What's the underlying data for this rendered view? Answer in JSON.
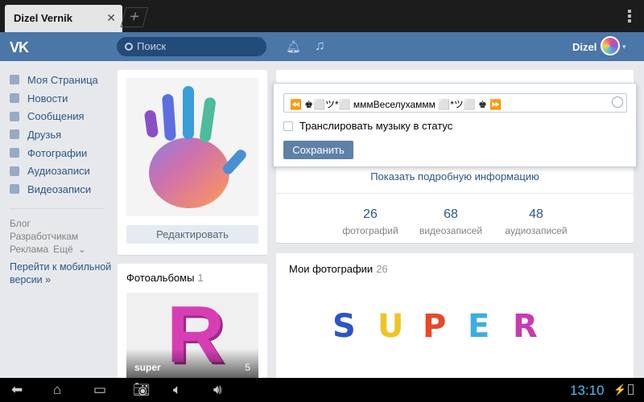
{
  "browser": {
    "tab_title": "Dizel Vernik",
    "tab_close": "✕",
    "new_tab": "+"
  },
  "header": {
    "logo": "VK",
    "search_placeholder": "Поиск",
    "username": "Dizel",
    "caret": "▾"
  },
  "sidebar": {
    "items": [
      {
        "label": "Моя Страница",
        "icon": "home-icon"
      },
      {
        "label": "Новости",
        "icon": "news-icon"
      },
      {
        "label": "Сообщения",
        "icon": "messages-icon"
      },
      {
        "label": "Друзья",
        "icon": "friends-icon"
      },
      {
        "label": "Фотографии",
        "icon": "camera-icon"
      },
      {
        "label": "Аудиозаписи",
        "icon": "music-icon"
      },
      {
        "label": "Видеозаписи",
        "icon": "video-icon"
      }
    ],
    "blog": "Блог",
    "developers": "Разработчикам",
    "ads": "Реклама",
    "more": "Ещё",
    "mobile_link": "Перейти к мобильной версии »"
  },
  "profile": {
    "edit_button": "Редактировать"
  },
  "albums": {
    "title": "Фотоальбомы",
    "count": "1",
    "album_name": "super",
    "album_count": "5"
  },
  "info": {
    "show_details": "Показать подробную информацию",
    "counters": [
      {
        "value": "26",
        "label": "фотографий"
      },
      {
        "value": "68",
        "label": "видеозаписей"
      },
      {
        "value": "48",
        "label": "аудиозаписей"
      }
    ]
  },
  "photos": {
    "title": "Мои фотографии",
    "count": "26",
    "letters": [
      "S",
      "U",
      "P",
      "E",
      "R"
    ]
  },
  "status_popup": {
    "status_text": "⏪ ♚⬜ツ*⬜ ᴍᴍᴍВеселухаᴍᴍᴍ ⬜*ツ⬜ ♚ ⏩",
    "music_checkbox_label": "Транслировать музыку в статус",
    "save_button": "Сохранить"
  },
  "systembar": {
    "time": "13:10"
  },
  "colors": {
    "vk_blue": "#4a76a8",
    "link": "#2a5885",
    "clock": "#4ac0f0"
  }
}
